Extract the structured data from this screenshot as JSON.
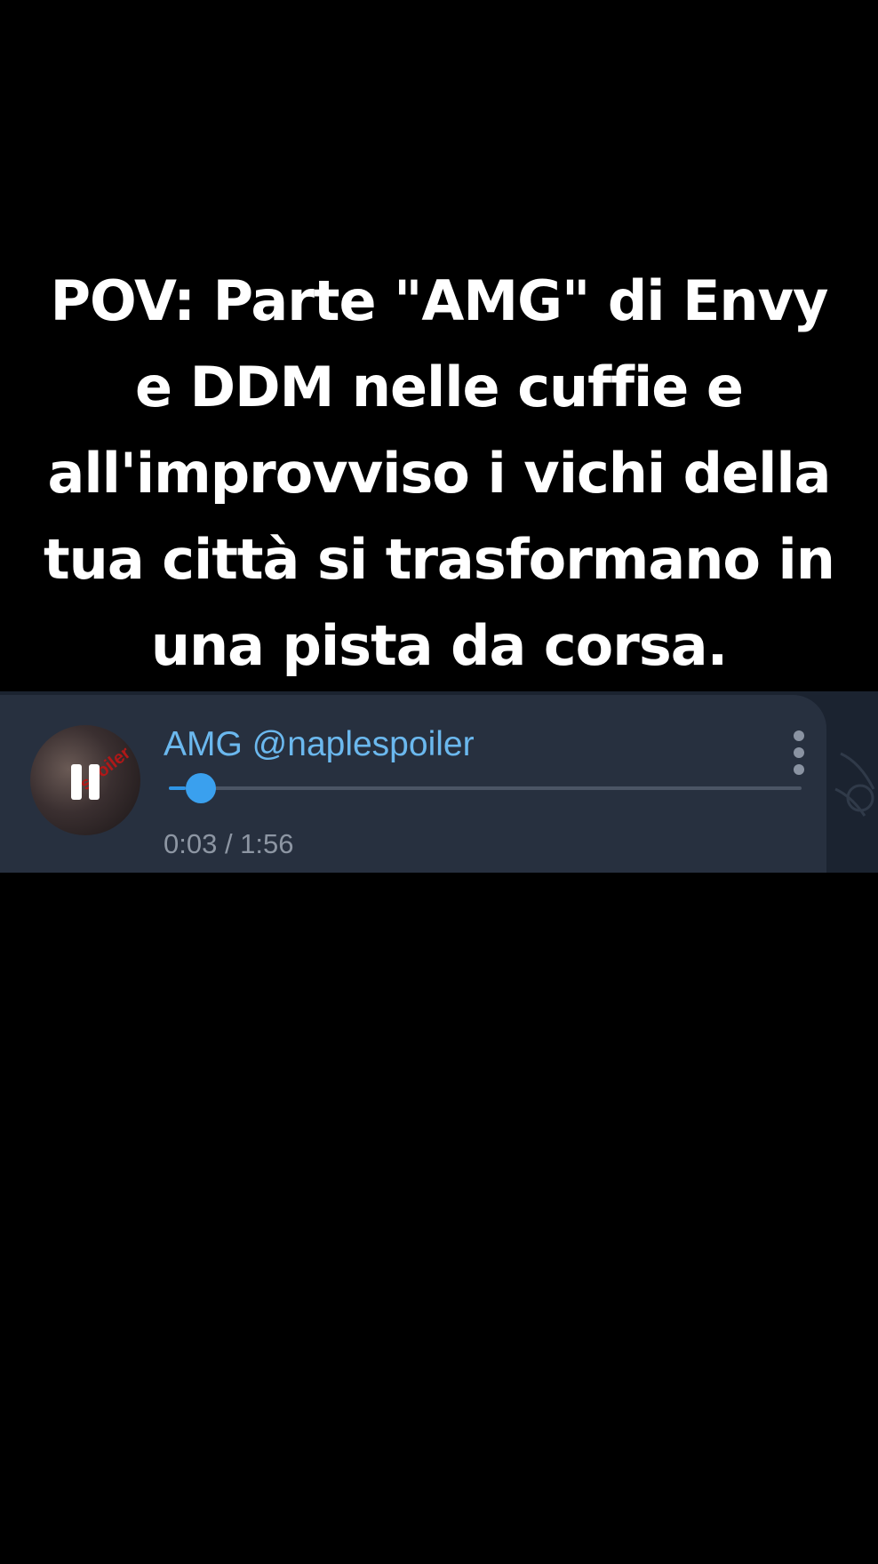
{
  "caption": {
    "lines": [
      "POV: Parte \"AMG\" di Envy",
      "e DDM nelle cuffie e",
      "all'improvviso i vichi della",
      "tua città si trasformano in",
      "una pista da corsa."
    ]
  },
  "player": {
    "title": "AMG @naplespoiler",
    "cover_text": "spoiler",
    "time": "0:03 / 1:56",
    "progress_fraction": 0.026,
    "state_icon": "pause-icon",
    "menu_icon": "more-vertical-icon",
    "colors": {
      "title": "#6bb8ee",
      "accent": "#3aa0ee",
      "card": "#27303f"
    }
  }
}
